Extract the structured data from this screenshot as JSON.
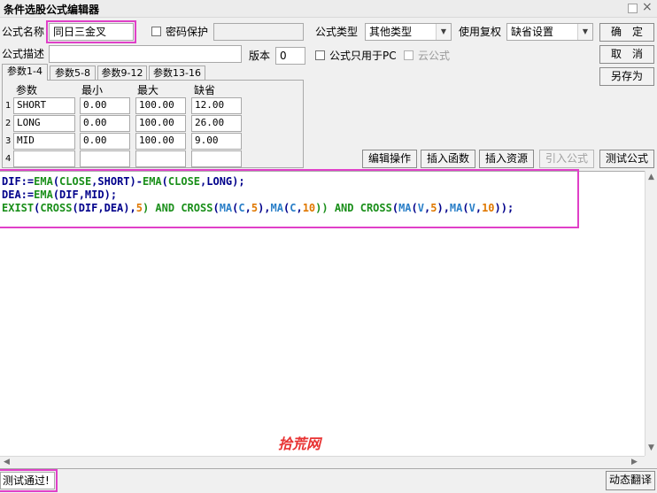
{
  "window": {
    "title": "条件选股公式编辑器"
  },
  "form": {
    "name_label": "公式名称",
    "name_value": "同日三金叉",
    "password_label": "密码保护",
    "password_value": "",
    "type_label": "公式类型",
    "type_value": "其他类型",
    "restore_label": "使用复权",
    "restore_value": "缺省设置",
    "desc_label": "公式描述",
    "desc_value": "",
    "version_label": "版本",
    "version_value": "0",
    "pc_only_label": "公式只用于PC",
    "cloud_label": "云公式"
  },
  "buttons": {
    "ok": "确　定",
    "cancel": "取　消",
    "save_as": "另存为",
    "edit_ops": "编辑操作",
    "insert_func": "插入函数",
    "insert_res": "插入资源",
    "import_formula": "引入公式",
    "test_formula": "测试公式",
    "dynamic_translate": "动态翻译"
  },
  "tabs": [
    "参数1-4",
    "参数5-8",
    "参数9-12",
    "参数13-16"
  ],
  "params": {
    "headers": [
      "参数",
      "最小",
      "最大",
      "缺省"
    ],
    "rows": [
      {
        "no": "1",
        "name": "SHORT",
        "min": "0.00",
        "max": "100.00",
        "default": "12.00"
      },
      {
        "no": "2",
        "name": "LONG",
        "min": "0.00",
        "max": "100.00",
        "default": "26.00"
      },
      {
        "no": "3",
        "name": "MID",
        "min": "0.00",
        "max": "100.00",
        "default": "9.00"
      },
      {
        "no": "4",
        "name": "",
        "min": "",
        "max": "",
        "default": ""
      }
    ]
  },
  "code": {
    "line1": [
      {
        "t": "DIF:=",
        "c": "kw"
      },
      {
        "t": "EMA",
        "c": "fn"
      },
      {
        "t": "(",
        "c": "kw"
      },
      {
        "t": "CLOSE",
        "c": "fn"
      },
      {
        "t": ",SHORT)-",
        "c": "kw"
      },
      {
        "t": "EMA",
        "c": "fn"
      },
      {
        "t": "(",
        "c": "kw"
      },
      {
        "t": "CLOSE",
        "c": "fn"
      },
      {
        "t": ",LONG);",
        "c": "kw"
      }
    ],
    "line2": [
      {
        "t": "DEA:=",
        "c": "kw"
      },
      {
        "t": "EMA",
        "c": "fn"
      },
      {
        "t": "(DIF,MID);",
        "c": "kw"
      }
    ],
    "line3": [
      {
        "t": "EXIST",
        "c": "fn"
      },
      {
        "t": "(",
        "c": "kw"
      },
      {
        "t": "CROSS",
        "c": "fn"
      },
      {
        "t": "(DIF,DEA),",
        "c": "kw"
      },
      {
        "t": "5",
        "c": "num"
      },
      {
        "t": ") AND ",
        "c": "fn"
      },
      {
        "t": "CROSS",
        "c": "fn"
      },
      {
        "t": "(",
        "c": "kw"
      },
      {
        "t": "MA",
        "c": "fn2"
      },
      {
        "t": "(",
        "c": "kw"
      },
      {
        "t": "C",
        "c": "fn2"
      },
      {
        "t": ",",
        "c": "kw"
      },
      {
        "t": "5",
        "c": "num"
      },
      {
        "t": "),",
        "c": "kw"
      },
      {
        "t": "MA",
        "c": "fn2"
      },
      {
        "t": "(",
        "c": "kw"
      },
      {
        "t": "C",
        "c": "fn2"
      },
      {
        "t": ",",
        "c": "kw"
      },
      {
        "t": "10",
        "c": "num"
      },
      {
        "t": ")) AND ",
        "c": "fn"
      },
      {
        "t": "CROSS",
        "c": "fn"
      },
      {
        "t": "(",
        "c": "kw"
      },
      {
        "t": "MA",
        "c": "fn2"
      },
      {
        "t": "(",
        "c": "kw"
      },
      {
        "t": "V",
        "c": "fn2"
      },
      {
        "t": ",",
        "c": "kw"
      },
      {
        "t": "5",
        "c": "num"
      },
      {
        "t": "),",
        "c": "kw"
      },
      {
        "t": "MA",
        "c": "fn2"
      },
      {
        "t": "(",
        "c": "kw"
      },
      {
        "t": "V",
        "c": "fn2"
      },
      {
        "t": ",",
        "c": "kw"
      },
      {
        "t": "10",
        "c": "num"
      },
      {
        "t": "));",
        "c": "kw"
      }
    ]
  },
  "watermark": "拾荒网",
  "status": {
    "message": "测试通过!"
  },
  "colors": {
    "highlight": "#e040c8",
    "keyword": "#00008b",
    "function": "#1a8f1a",
    "ma_func": "#2a7fc8",
    "number": "#e07800"
  }
}
